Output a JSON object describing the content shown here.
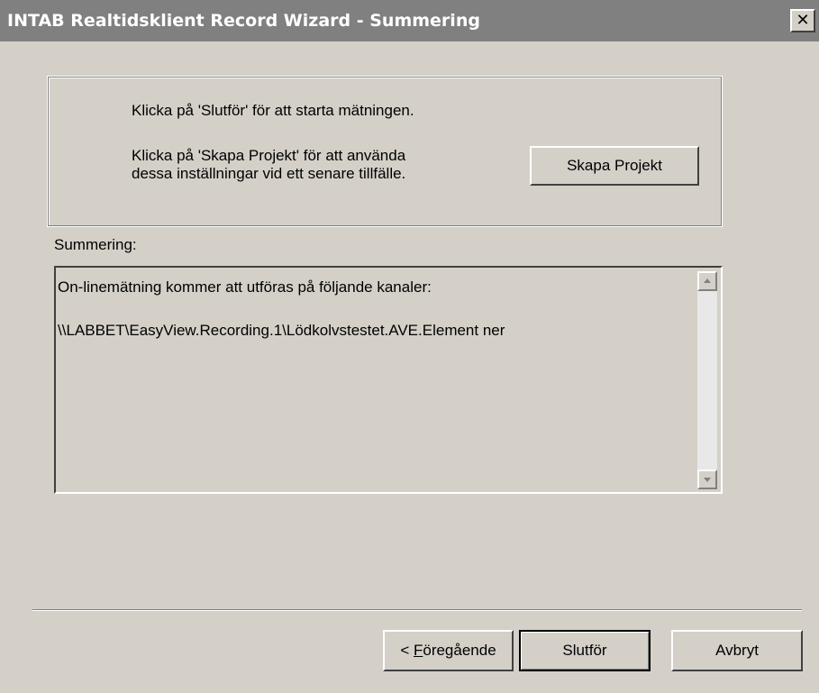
{
  "window": {
    "title": "INTAB Realtidsklient Record Wizard - Summering",
    "close_glyph": "✕"
  },
  "instructions": {
    "line1": "Klicka på 'Slutför' för att starta mätningen.",
    "line2": "Klicka på 'Skapa Projekt' för att använda",
    "line3": "dessa inställningar vid ett senare tillfälle.",
    "create_project_button": "Skapa Projekt"
  },
  "summary": {
    "label": "Summering:",
    "line1": "On-linemätning kommer att utföras på följande kanaler:",
    "line2": "\\\\LABBET\\EasyView.Recording.1\\Lödkolvstestet.AVE.Element ner"
  },
  "footer": {
    "prev_prefix": "< ",
    "prev_mnemonic": "F",
    "prev_rest": "öregående",
    "finish_button": "Slutför",
    "cancel_button": "Avbryt"
  },
  "colors": {
    "face": "#d4d0c8",
    "titlebar": "#808080",
    "title_text": "#ffffff"
  }
}
